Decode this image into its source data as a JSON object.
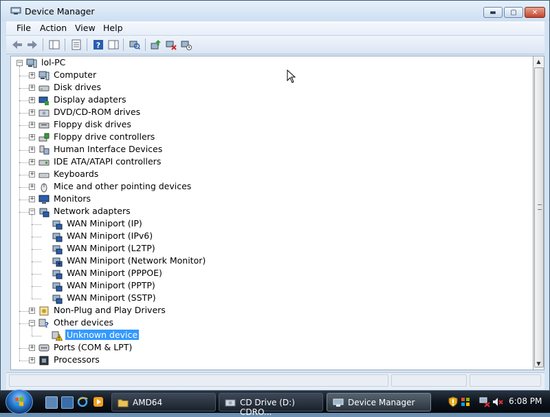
{
  "window": {
    "title": "Device Manager"
  },
  "menu": [
    "File",
    "Action",
    "View",
    "Help"
  ],
  "tree": {
    "root": "lol-PC",
    "rows": [
      {
        "label": "Computer",
        "expander": "+",
        "level": 1,
        "icon": "computer-icon"
      },
      {
        "label": "Disk drives",
        "expander": "+",
        "level": 1,
        "icon": "disk-drive-icon"
      },
      {
        "label": "Display adapters",
        "expander": "+",
        "level": 1,
        "icon": "display-adapter-icon"
      },
      {
        "label": "DVD/CD-ROM drives",
        "expander": "+",
        "level": 1,
        "icon": "dvd-drive-icon"
      },
      {
        "label": "Floppy disk drives",
        "expander": "+",
        "level": 1,
        "icon": "floppy-drive-icon"
      },
      {
        "label": "Floppy drive controllers",
        "expander": "+",
        "level": 1,
        "icon": "floppy-controller-icon"
      },
      {
        "label": "Human Interface Devices",
        "expander": "+",
        "level": 1,
        "icon": "hid-icon"
      },
      {
        "label": "IDE ATA/ATAPI controllers",
        "expander": "+",
        "level": 1,
        "icon": "ide-controller-icon"
      },
      {
        "label": "Keyboards",
        "expander": "+",
        "level": 1,
        "icon": "keyboard-icon"
      },
      {
        "label": "Mice and other pointing devices",
        "expander": "+",
        "level": 1,
        "icon": "mouse-icon"
      },
      {
        "label": "Monitors",
        "expander": "+",
        "level": 1,
        "icon": "monitor-icon"
      },
      {
        "label": "Network adapters",
        "expander": "−",
        "level": 1,
        "icon": "network-adapter-icon"
      },
      {
        "label": "WAN Miniport (IP)",
        "level": 2,
        "icon": "network-adapter-icon"
      },
      {
        "label": "WAN Miniport (IPv6)",
        "level": 2,
        "icon": "network-adapter-icon"
      },
      {
        "label": "WAN Miniport (L2TP)",
        "level": 2,
        "icon": "network-adapter-icon"
      },
      {
        "label": "WAN Miniport (Network Monitor)",
        "level": 2,
        "icon": "network-monitor-icon"
      },
      {
        "label": "WAN Miniport (PPPOE)",
        "level": 2,
        "icon": "network-adapter-icon"
      },
      {
        "label": "WAN Miniport (PPTP)",
        "level": 2,
        "icon": "network-adapter-icon"
      },
      {
        "label": "WAN Miniport (SSTP)",
        "level": 2,
        "icon": "network-adapter-icon"
      },
      {
        "label": "Non-Plug and Play Drivers",
        "expander": "+",
        "level": 1,
        "icon": "driver-icon"
      },
      {
        "label": "Other devices",
        "expander": "−",
        "level": 1,
        "icon": "other-devices-icon"
      },
      {
        "label": "Unknown device",
        "level": 2,
        "icon": "warning-device-icon",
        "selected": true
      },
      {
        "label": "Ports (COM & LPT)",
        "expander": "+",
        "level": 1,
        "icon": "port-icon"
      },
      {
        "label": "Processors",
        "expander": "+",
        "level": 1,
        "icon": "processor-icon"
      }
    ]
  },
  "taskbar": {
    "buttons": [
      {
        "label": "AMD64",
        "icon": "folder-icon",
        "active": false
      },
      {
        "label": "CD Drive (D:) CDRO...",
        "icon": "cd-drive-icon",
        "active": false
      },
      {
        "label": "Device Manager",
        "icon": "device-manager-icon",
        "active": true
      }
    ],
    "clock": "6:08 PM"
  },
  "colors": {
    "selection": "#3399ff",
    "window_frame": "#d4e3f2"
  }
}
